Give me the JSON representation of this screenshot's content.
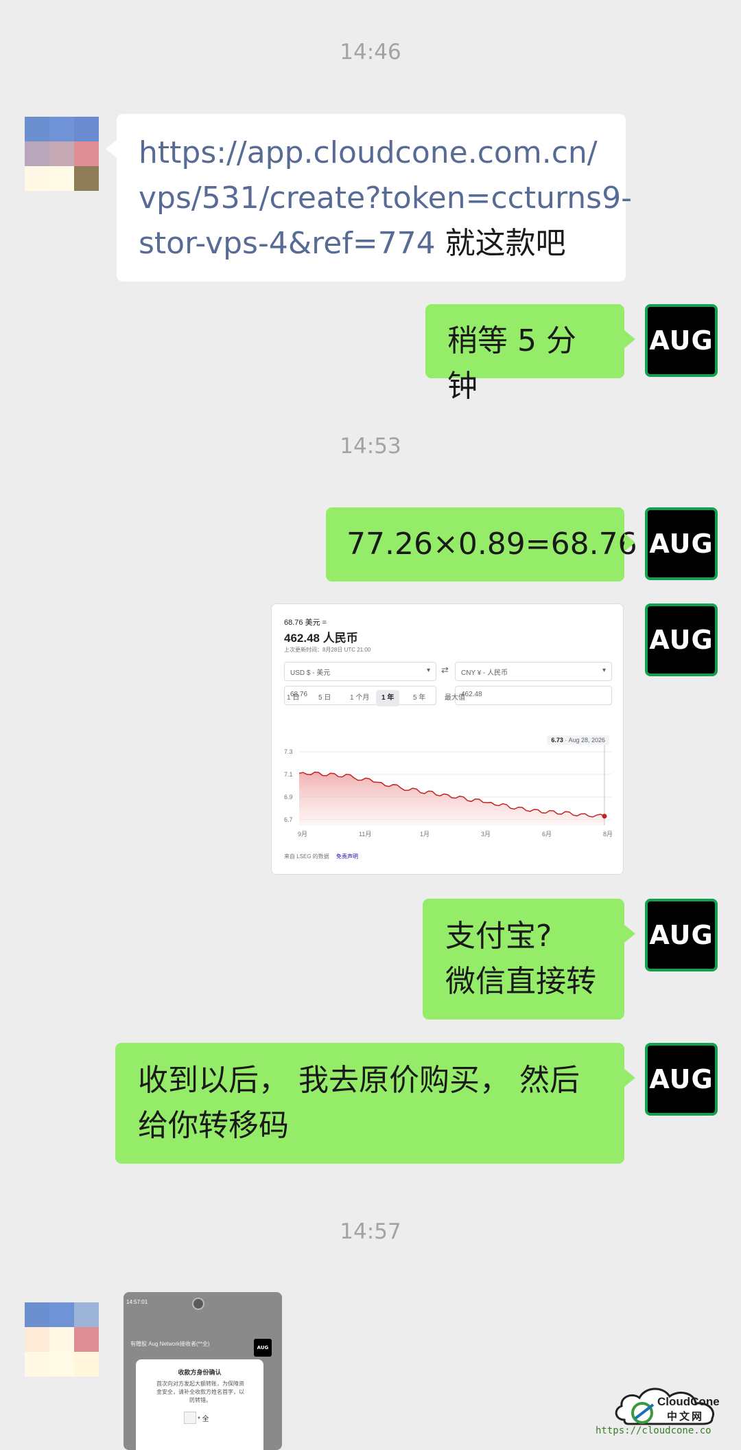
{
  "chat": {
    "time_1": "14:46",
    "msg_link_1": "https://app.cloudcone.com.cn/",
    "msg_link_2": "vps/531/create?token=ccturns9-",
    "msg_link_3": "stor-vps-4&ref=774",
    "msg_link_suffix": " 就这款吧",
    "msg_wait": "稍等 5 分钟",
    "time_2": "14:53",
    "msg_calc": "77.26×0.89=68.76",
    "msg_pay_1": "支付宝?",
    "msg_pay_2": "微信直接转",
    "msg_buy_1": "收到以后， 我去原价购买， 然后",
    "msg_buy_2": "给你转移码",
    "time_3": "14:57",
    "avatar_label": "AUG"
  },
  "currency_card": {
    "from_amount": "68.76 美元 =",
    "to_amount": "462.48 人民币",
    "updated": "上次更新时间：8月28日 UTC 21:00",
    "from_currency": "USD $ - 美元",
    "to_currency": "CNY ¥ - 人民币",
    "from_value": "68.76",
    "to_value": "462.48",
    "ranges": [
      "1 日",
      "5 日",
      "1 个月",
      "1 年",
      "5 年",
      "最大值"
    ],
    "active_range": "1 年",
    "tooltip_value": "6.73",
    "tooltip_date": "Aug 28, 2026",
    "source": "来自 LSEG 的数据",
    "disclaimer": "免责声明"
  },
  "chart_data": {
    "type": "area",
    "y_ticks": [
      "7.3",
      "7.1",
      "6.9",
      "6.7"
    ],
    "x_ticks": [
      "9月",
      "11月",
      "1月",
      "3月",
      "6月",
      "8月"
    ],
    "ylim": [
      6.65,
      7.3
    ],
    "values": [
      7.11,
      7.1,
      7.12,
      7.09,
      7.11,
      7.08,
      7.1,
      7.07,
      7.05,
      7.06,
      7.03,
      7.0,
      7.01,
      6.98,
      6.96,
      6.97,
      6.93,
      6.95,
      6.91,
      6.92,
      6.89,
      6.9,
      6.86,
      6.88,
      6.85,
      6.83,
      6.84,
      6.8,
      6.81,
      6.78,
      6.79,
      6.76,
      6.78,
      6.75,
      6.77,
      6.74,
      6.75,
      6.73,
      6.74,
      6.73
    ],
    "color": "#c5221f"
  },
  "phone_shot": {
    "status_time": "14:57:01",
    "transfer_line": "有赠股 Aug Network接收者(**全)",
    "dialog_title": "收款方身份确认",
    "dialog_body_1": "首次向对方发起大额转账，为保障资",
    "dialog_body_2": "金安全，请补全收款方姓名首字，以",
    "dialog_body_3": "防转错。",
    "name_suffix": "* 全"
  },
  "watermark": {
    "logo_name": "CloudCone",
    "logo_sub": "中文网",
    "url": "https://cloudcone.co"
  },
  "colors": {
    "background": "#ededed",
    "out_bubble": "#95ec69",
    "in_bubble": "#ffffff",
    "link": "#576b95",
    "chart_line": "#c5221f"
  }
}
